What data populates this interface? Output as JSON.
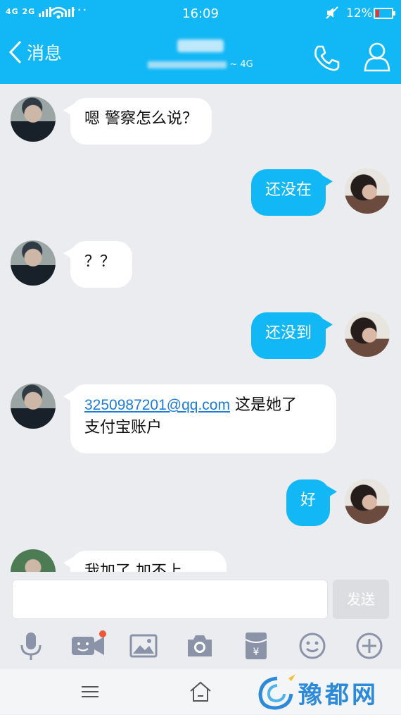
{
  "status": {
    "signal": "4G 2G",
    "time": "16:09",
    "battery_text": "12%"
  },
  "header": {
    "back_label": "消息",
    "network": "~ 4G"
  },
  "messages": [
    {
      "side": "in",
      "text": "嗯  警察怎么说？"
    },
    {
      "side": "out",
      "text": "还没在"
    },
    {
      "side": "in",
      "text": "？？"
    },
    {
      "side": "out",
      "text": "还没到"
    },
    {
      "side": "in",
      "link": "3250987201@qq.com",
      "text_after": " 这是她了",
      "text_line2": "支付宝账户"
    },
    {
      "side": "out",
      "text": "好"
    },
    {
      "side": "in",
      "text": "我加了  加不上"
    }
  ],
  "composer": {
    "send_label": "发送",
    "input_value": ""
  },
  "toolbar": {
    "icons": [
      "mic-icon",
      "video-icon",
      "image-icon",
      "camera-icon",
      "red-packet-icon",
      "emoji-icon",
      "plus-icon"
    ]
  },
  "watermark": {
    "text": "豫都网"
  },
  "colors": {
    "accent": "#12b7f5",
    "background": "#ebecf0"
  }
}
